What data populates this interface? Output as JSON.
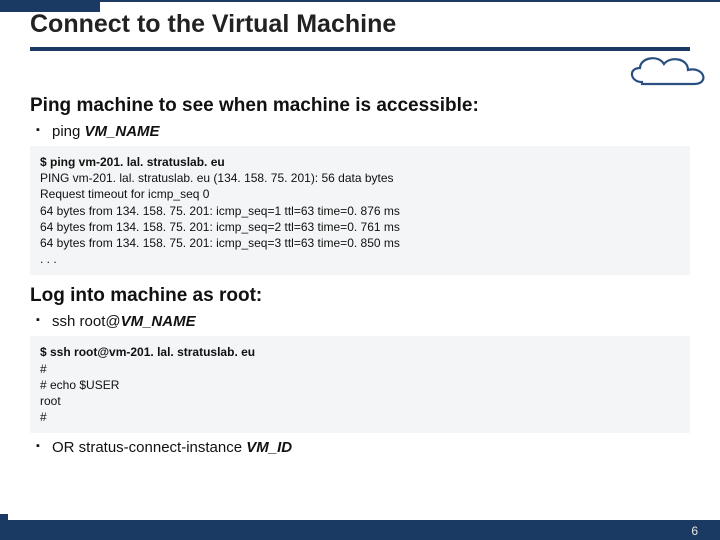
{
  "title": "Connect to the Virtual Machine",
  "section1": {
    "heading": "Ping machine to see when machine is accessible:",
    "bullet_prefix": "ping ",
    "bullet_ital": "VM_NAME",
    "code": {
      "cmd": "$ ping vm-201. lal. stratuslab. eu",
      "l1": "PING vm-201. lal. stratuslab. eu (134. 158. 75. 201): 56 data bytes",
      "l2": "Request timeout for icmp_seq 0",
      "l3": "64 bytes from 134. 158. 75. 201: icmp_seq=1 ttl=63 time=0. 876 ms",
      "l4": "64 bytes from 134. 158. 75. 201: icmp_seq=2 ttl=63 time=0. 761 ms",
      "l5": "64 bytes from 134. 158. 75. 201: icmp_seq=3 ttl=63 time=0. 850 ms",
      "l6": ". . ."
    }
  },
  "section2": {
    "heading": "Log into machine as root:",
    "bullet_prefix": "ssh root@",
    "bullet_ital": "VM_NAME",
    "code": {
      "cmd": "$ ssh root@vm-201. lal. stratuslab. eu",
      "l1": "# ",
      "l2": "# echo $USER",
      "l3": "root",
      "l4": "# "
    },
    "bullet2_prefix": "OR stratus-connect-instance ",
    "bullet2_ital": "VM_ID"
  },
  "page_number": "6"
}
